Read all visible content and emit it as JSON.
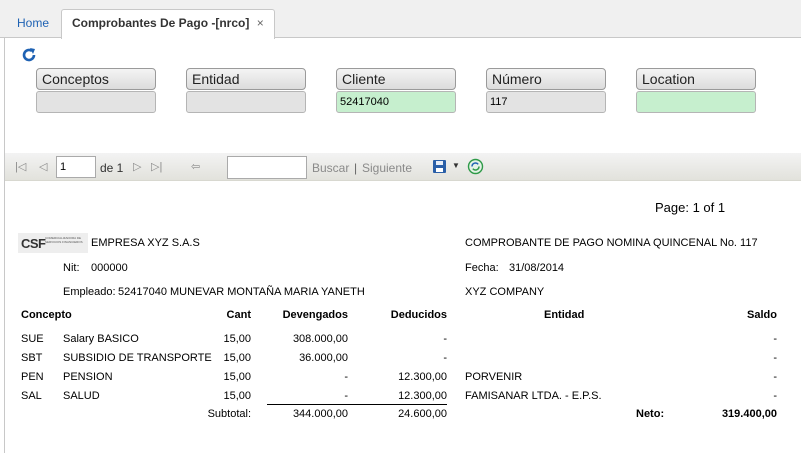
{
  "tabs": {
    "home": "Home",
    "active": "Comprobantes De Pago -[nrco]",
    "close": "×"
  },
  "filters": [
    {
      "label": "Conceptos",
      "value": "",
      "highlight": false
    },
    {
      "label": "Entidad",
      "value": "",
      "highlight": false
    },
    {
      "label": "Cliente",
      "value": "52417040",
      "highlight": true
    },
    {
      "label": "Número",
      "value": "117",
      "highlight": false
    },
    {
      "label": "Location",
      "value": "",
      "highlight": true
    }
  ],
  "toolbar": {
    "page_value": "1",
    "of_text": "de 1",
    "buscar": "Buscar",
    "separator": "|",
    "siguiente": "Siguiente"
  },
  "report": {
    "page_text": "Page:  1 of 1",
    "logo_text": "CSF",
    "logo_sub": "COMERCIALIZADORA DE SERVICIOS FINANCIEROS",
    "company": "EMPRESA XYZ S.A.S",
    "nit_label": "Nit:",
    "nit_value": "000000",
    "employee_label": "Empleado:",
    "employee_value": "52417040  MUNEVAR MONTAÑA MARIA YANETH",
    "doc_title": "COMPROBANTE DE PAGO NOMINA  QUINCENAL  No. 117",
    "fecha_label": "Fecha:",
    "fecha_value": "31/08/2014",
    "company2": "XYZ COMPANY",
    "headers": {
      "concepto": "Concepto",
      "cant": "Cant",
      "devengados": "Devengados",
      "deducidos": "Deducidos",
      "entidad": "Entidad",
      "saldo": "Saldo"
    },
    "rows": [
      {
        "code": "SUE",
        "desc": "Salary BASICO",
        "cant": "15,00",
        "dev": "308.000,00",
        "ded": "-",
        "ent": "",
        "saldo": "-"
      },
      {
        "code": "SBT",
        "desc": "SUBSIDIO DE TRANSPORTE",
        "cant": "15,00",
        "dev": "36.000,00",
        "ded": "-",
        "ent": "",
        "saldo": "-"
      },
      {
        "code": "PEN",
        "desc": "PENSION",
        "cant": "15,00",
        "dev": "-",
        "ded": "12.300,00",
        "ent": "PORVENIR",
        "saldo": "-"
      },
      {
        "code": "SAL",
        "desc": "SALUD",
        "cant": "15,00",
        "dev": "-",
        "ded": "12.300,00",
        "ent": "FAMISANAR LTDA.  -  E.P.S.",
        "saldo": "-"
      }
    ],
    "subtotal_label": "Subtotal:",
    "subtotal_dev": "344.000,00",
    "subtotal_ded": "24.600,00",
    "neto_label": "Neto:",
    "neto_value": "319.400,00"
  }
}
